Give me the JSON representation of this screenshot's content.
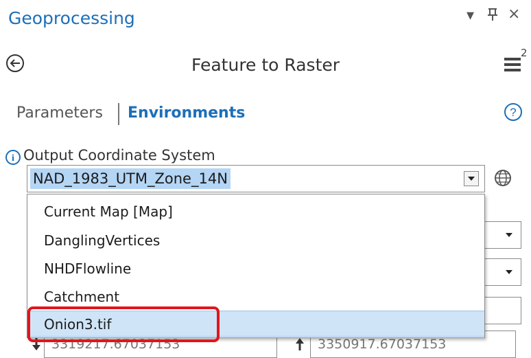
{
  "pane": {
    "title": "Geoprocessing",
    "controls": {
      "dropdown": "▾",
      "pin": "ф",
      "close": "×"
    }
  },
  "tool": {
    "title": "Feature to Raster",
    "menu_badge": "2"
  },
  "tabs": [
    {
      "label": "Parameters",
      "active": false
    },
    {
      "label": "Environments",
      "active": true
    }
  ],
  "environment": {
    "label": "Output Coordinate System",
    "value": "NAD_1983_UTM_Zone_14N",
    "options": [
      {
        "label": "Current Map [Map]"
      },
      {
        "label": "DanglingVertices"
      },
      {
        "label": "NHDFlowline"
      },
      {
        "label": "Catchment"
      },
      {
        "label": "Onion3.tif",
        "selected": true,
        "highlighted": true
      }
    ]
  },
  "extent": {
    "bottom": "3319217.67037153",
    "top": "3350917.67037153"
  },
  "colors": {
    "accent": "#1d6fb8",
    "selection": "#cfe4f7",
    "annotation": "#e1161b"
  }
}
